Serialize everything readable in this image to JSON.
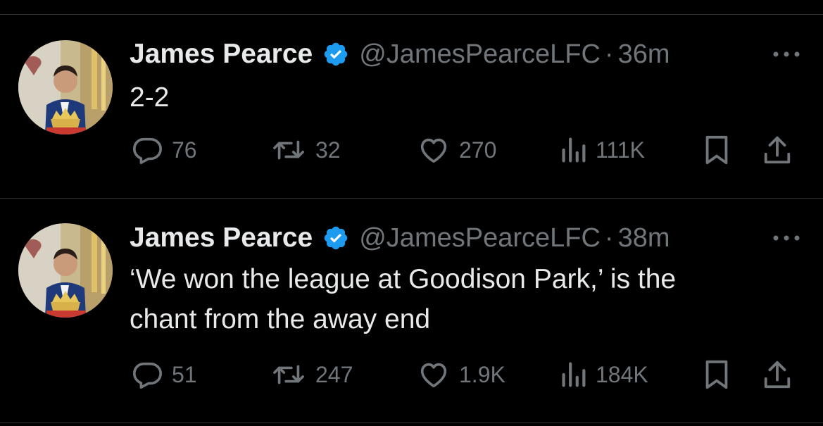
{
  "colors": {
    "background": "#000000",
    "text": "#e7e9ea",
    "muted": "#71767b",
    "verified": "#1d9bf0",
    "divider": "#2f3336"
  },
  "tweets": [
    {
      "author": {
        "name": "James Pearce",
        "handle": "@JamesPearceLFC",
        "verified_icon": "verified-badge-icon",
        "avatar": "profile-photo"
      },
      "separator": "·",
      "time": "36m",
      "text": "2-2",
      "actions": {
        "replies": "76",
        "retweets": "32",
        "likes": "270",
        "views": "111K"
      },
      "icons": [
        "reply-icon",
        "retweet-icon",
        "like-icon",
        "views-icon",
        "bookmark-icon",
        "share-icon",
        "more-icon"
      ]
    },
    {
      "author": {
        "name": "James Pearce",
        "handle": "@JamesPearceLFC",
        "verified_icon": "verified-badge-icon",
        "avatar": "profile-photo"
      },
      "separator": "·",
      "time": "38m",
      "text": "‘We won the league at Goodison Park,’ is the\nchant from the away end",
      "actions": {
        "replies": "51",
        "retweets": "247",
        "likes": "1.9K",
        "views": "184K"
      },
      "icons": [
        "reply-icon",
        "retweet-icon",
        "like-icon",
        "views-icon",
        "bookmark-icon",
        "share-icon",
        "more-icon"
      ]
    }
  ]
}
